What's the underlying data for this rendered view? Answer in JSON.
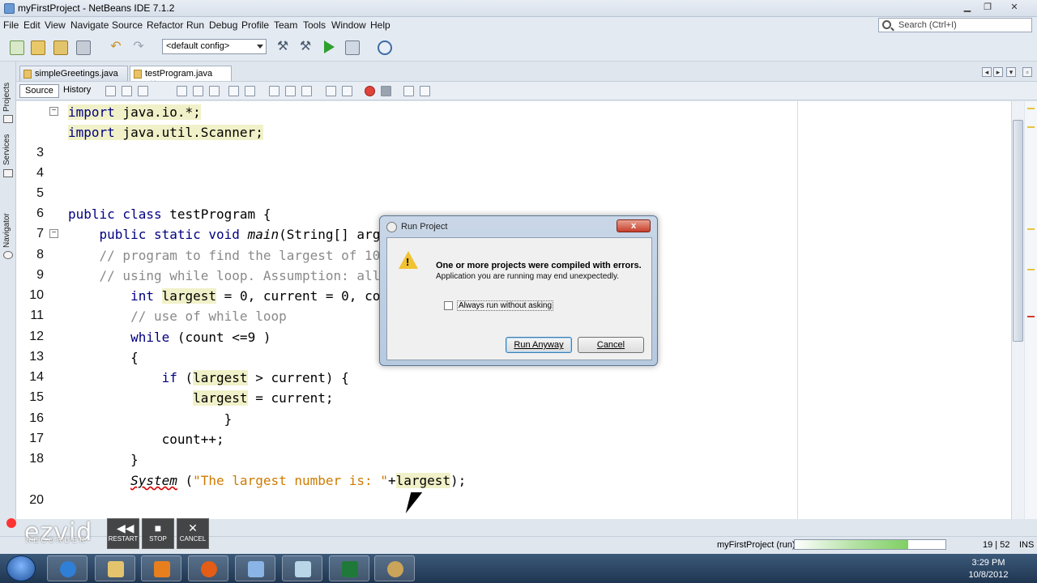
{
  "window": {
    "title": "myFirstProject - NetBeans IDE 7.1.2"
  },
  "menu": [
    "File",
    "Edit",
    "View",
    "Navigate",
    "Source",
    "Refactor",
    "Run",
    "Debug",
    "Profile",
    "Team",
    "Tools",
    "Window",
    "Help"
  ],
  "search": {
    "placeholder": "Search (Ctrl+I)"
  },
  "toolbar": {
    "config": "<default config>"
  },
  "sidebar": {
    "tabs": [
      "Projects",
      "Services",
      "Navigator"
    ]
  },
  "tabs": [
    {
      "label": "simpleGreetings.java",
      "active": false
    },
    {
      "label": "testProgram.java",
      "active": true
    }
  ],
  "editor_toolbar": {
    "source": "Source",
    "history": "History"
  },
  "code": {
    "line_numbers": [
      "",
      "",
      "3",
      "4",
      "5",
      "6",
      "7",
      "8",
      "9",
      "10",
      "11",
      "12",
      "13",
      "14",
      "15",
      "16",
      "17",
      "18",
      "",
      "20"
    ],
    "line1": {
      "kw": "import",
      "rest": " java.io.*;"
    },
    "line2": {
      "kw": "import",
      "rest": " java.util.Scanner;"
    },
    "line6": {
      "kw": "public class",
      "rest": " testProgram {"
    },
    "line7": {
      "kw": "public static void",
      "fn": "main",
      "rest": "(String[] args) {"
    },
    "line8": "// program to find the largest of 10 numbers, use of increment operator",
    "line9": "// using while loop. Assumption: all numbers are > 0",
    "line10": {
      "kw": "int",
      "var": "largest",
      "rest": " = 0, current = 0, count = 0;"
    },
    "line11": "// use of while loop",
    "line12": {
      "kw": "while",
      "rest": " (count <=9 )"
    },
    "line13": "{",
    "line14": {
      "kw": "if",
      "pre": " (",
      "var": "largest",
      "rest": " > current) {"
    },
    "line15": {
      "var": "largest",
      "rest": " = current;"
    },
    "line16": "}",
    "line17": "count++;",
    "line18": "}",
    "line19": {
      "err": "System",
      "pre": " (",
      "str": "\"The largest number is: \"",
      "plus": "+",
      "var": "largest",
      "rest": ");"
    }
  },
  "dialog": {
    "title": "Run Project",
    "close": "x",
    "message_bold": "One or more projects were compiled with errors.",
    "message": "Application you are running may end unexpectedly.",
    "checkbox": "Always run without asking",
    "run_button": "Run Anyway",
    "cancel_button": "Cancel"
  },
  "statusbar": {
    "project": "myFirstProject (run)",
    "position": "19 | 52",
    "mode": "INS",
    "progress": 0.75
  },
  "recorder": {
    "logo": "ezvid",
    "subtitle": "RECORDER",
    "restart": "RESTART",
    "stop": "STOP",
    "cancel": "CANCEL"
  },
  "clock": {
    "time": "3:29 PM",
    "date": "10/8/2012"
  },
  "colors": {
    "keyword": "#000080",
    "comment": "#8a8a8a",
    "string": "#ce7b00",
    "highlight": "#f1f1c9"
  }
}
